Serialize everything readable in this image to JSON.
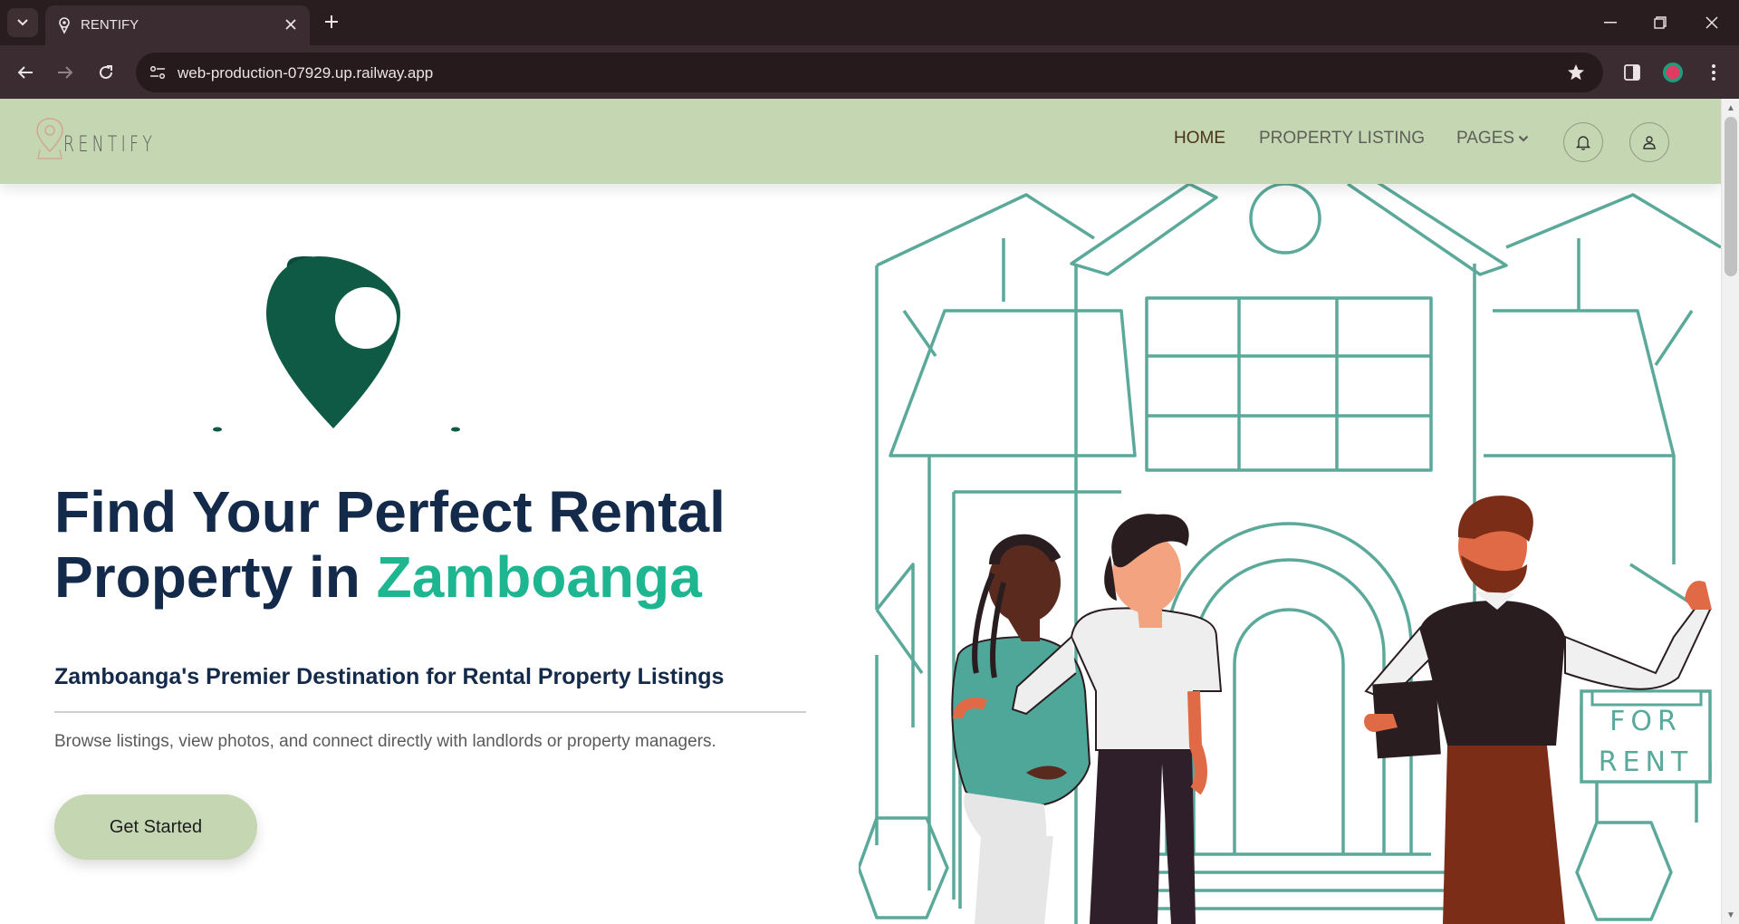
{
  "browser": {
    "tab": {
      "title": "RENTIFY"
    },
    "address_bar": {
      "url": "web-production-07929.up.railway.app"
    }
  },
  "site": {
    "logo": {
      "wordmark": "RENTIFY"
    },
    "nav": {
      "home": "HOME",
      "listing": "PROPERTY LISTING",
      "pages": "PAGES"
    }
  },
  "hero": {
    "headline_part1": "Find Your Perfect Rental",
    "headline_part2": "Property in ",
    "headline_accent": "Zamboanga",
    "subheading": "Zamboanga's Premier Destination for Rental Property Listings",
    "description": "Browse listings, view photos, and connect directly with landlords or property managers.",
    "cta_label": "Get Started",
    "sign": {
      "line1": "FOR",
      "line2": "RENT"
    }
  },
  "colors": {
    "header_bg": "#c5d6b2",
    "headline": "#142a4a",
    "accent": "#1db690",
    "pin": "#0e5a45",
    "house_line": "#5aa99a"
  },
  "icons": [
    "tab-search-icon",
    "favicon-pin-icon",
    "close-icon",
    "plus-icon",
    "minimize-icon",
    "restore-icon",
    "window-close-icon",
    "back-icon",
    "forward-icon",
    "reload-icon",
    "site-info-icon",
    "star-icon",
    "side-panel-icon",
    "profile-icon",
    "menu-icon",
    "bell-icon",
    "user-icon",
    "chevron-down-icon",
    "location-pin-icon"
  ]
}
